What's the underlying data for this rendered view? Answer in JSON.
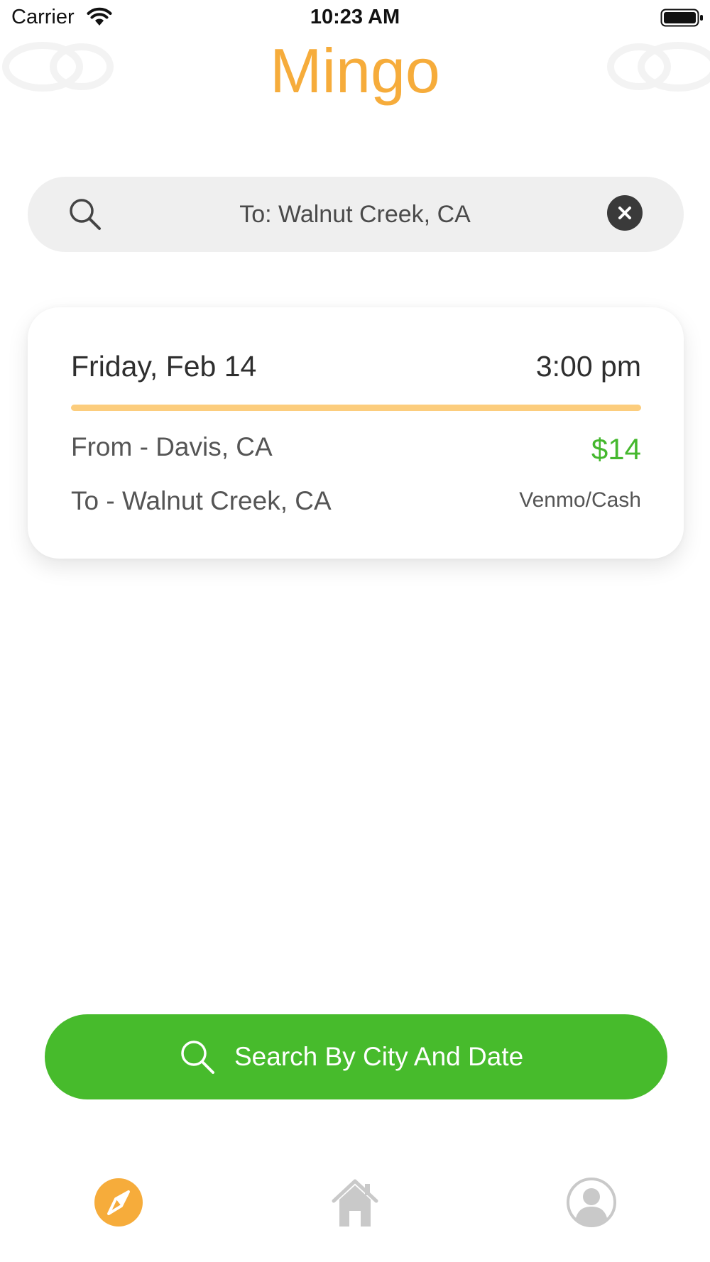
{
  "status_bar": {
    "carrier": "Carrier",
    "time": "10:23 AM",
    "icons": [
      "wifi-icon",
      "battery-icon"
    ]
  },
  "header": {
    "title": "Mingo"
  },
  "search": {
    "value": "To: Walnut Creek, CA",
    "icon": "search-icon",
    "clear_icon": "close-icon"
  },
  "ride_card": {
    "date": "Friday, Feb 14",
    "time": "3:00 pm",
    "from": "From - Davis, CA",
    "to": "To - Walnut Creek, CA",
    "price": "$14",
    "payment": "Venmo/Cash"
  },
  "city_search_button": {
    "label": "Search By City And Date",
    "icon": "search-icon"
  },
  "tab_bar": {
    "items": [
      {
        "name": "explore",
        "icon": "compass-icon",
        "active": true
      },
      {
        "name": "home",
        "icon": "home-icon",
        "active": false
      },
      {
        "name": "profile",
        "icon": "profile-icon",
        "active": false
      }
    ]
  },
  "colors": {
    "brand_orange": "#f6ac3b",
    "divider_orange": "#fccd7d",
    "price_green": "#45b82e",
    "button_green": "#47bb2c",
    "search_background": "#efefef",
    "inactive_icon": "#c9c9c9"
  }
}
